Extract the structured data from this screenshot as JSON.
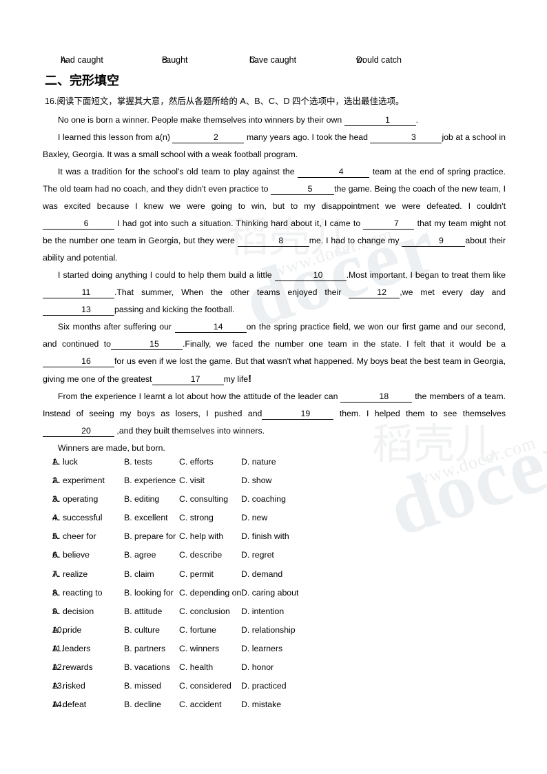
{
  "document": {
    "top_question_options": [
      {
        "key": "A.",
        "text": "had caught"
      },
      {
        "key": "B.",
        "text": "caught"
      },
      {
        "key": "C.",
        "text": "have caught"
      },
      {
        "key": "D.",
        "text": "would catch"
      }
    ],
    "section_heading": "二、完形填空",
    "instruction": "16.阅读下面短文，掌握其大意，然后从各题所给的 A、B、C、D 四个选项中，选出最佳选项。",
    "passage": {
      "p1_a": "No one is born a winner. People make themselves into winners by their own",
      "p1_b": ".",
      "p2_a": "I learned this lesson from a(n)",
      "p2_b": "many years ago. I took the head",
      "p2_c": "job at a school in Baxley, Georgia. It was a small school with a weak football program.",
      "p3_a": "It was a tradition for the school's old team to play against the",
      "p3_b": "team at the end of spring practice. The old team had no coach, and they didn't even practice to",
      "p3_c": "the game. Being the coach of the new team, I was excited because I knew we were going to win, but to my disappointment we were defeated. I couldn't",
      "p3_d": "I had got into such a situation. Thinking hard about it, I came to",
      "p3_e": "that my team might not be the number one team in Georgia, but they were",
      "p3_f": "me. I had to change my",
      "p3_g": "about their ability and potential.",
      "p4_a": "I started doing anything I could to help them build a little",
      "p4_b": ".Most important, I began to treat them like",
      "p4_c": ".That summer, When the other teams enjoyed their",
      "p4_d": ",we met every day and",
      "p4_e": "passing and kicking the football.",
      "p5_a": "Six months after suffering our",
      "p5_b": "on the spring practice field, we won our first game and our second, and continued to",
      "p5_c": ".Finally, we faced the number one team in the state. I felt that it would be a",
      "p5_d": "for us even if we lost the game. But that wasn't what happened. My boys beat the best team in Georgia, giving me one of the greatest",
      "p5_e": "my life",
      "p5_excl": "!",
      "p6_a": "From the experience I learnt a lot about how the attitude of the leader can",
      "p6_b": "the members of a team. Instead of seeing my boys as losers, I pushed and",
      "p6_c": "them. I helped them to see themselves",
      "p6_d": ",and they built themselves into winners.",
      "p7": "Winners are made, but born."
    },
    "blanks": {
      "b1": "1",
      "b2": "2",
      "b3": "3",
      "b4": "4",
      "b5": "5",
      "b6": "6",
      "b7": "7",
      "b8": "8",
      "b9": "9",
      "b10": "10",
      "b11": "11",
      "b12": "12",
      "b13": "13",
      "b14": "14",
      "b15": "15",
      "b16": "16",
      "b17": "17",
      "b18": "18",
      "b19": "19",
      "b20": "20"
    },
    "answer_choices": [
      {
        "num": "1.",
        "a": "A. luck",
        "b": "B. tests",
        "c": "C. efforts",
        "d": "D. nature"
      },
      {
        "num": "2.",
        "a": "A. experiment",
        "b": "B. experience",
        "c": "C. visit",
        "d": "D. show"
      },
      {
        "num": "3.",
        "a": "A. operating",
        "b": "B. editing",
        "c": "C. consulting",
        "d": "D. coaching"
      },
      {
        "num": "4.",
        "a": "A. successful",
        "b": "B. excellent",
        "c": "C. strong",
        "d": "D. new"
      },
      {
        "num": "5.",
        "a": "A. cheer for",
        "b": "B. prepare for",
        "c": "C. help with",
        "d": "D. finish with"
      },
      {
        "num": "6.",
        "a": "A. believe",
        "b": "B. agree",
        "c": "C. describe",
        "d": "D. regret"
      },
      {
        "num": "7.",
        "a": "A. realize",
        "b": "B. claim",
        "c": "C. permit",
        "d": "D. demand"
      },
      {
        "num": "8.",
        "a": "A. reacting to",
        "b": "B. looking for",
        "c": "C. depending on",
        "d": "D. caring about"
      },
      {
        "num": "9.",
        "a": "A. decision",
        "b": "B. attitude",
        "c": "C. conclusion",
        "d": "D. intention"
      },
      {
        "num": "10.",
        "a": "A. pride",
        "b": "B. culture",
        "c": "C. fortune",
        "d": "D. relationship"
      },
      {
        "num": "11.",
        "a": "A. leaders",
        "b": "B. partners",
        "c": "C. winners",
        "d": "D. learners"
      },
      {
        "num": "12.",
        "a": "A. rewards",
        "b": "B. vacations",
        "c": "C. health",
        "d": "D. honor"
      },
      {
        "num": "13.",
        "a": "A. risked",
        "b": "B. missed",
        "c": "C. considered",
        "d": "D. practiced"
      },
      {
        "num": "14.",
        "a": "A. defeat",
        "b": "B. decline",
        "c": "C. accident",
        "d": "D. mistake"
      }
    ],
    "watermarks": {
      "logo": "docer",
      "url": "www.docer.com",
      "cn": "稻壳儿"
    }
  }
}
